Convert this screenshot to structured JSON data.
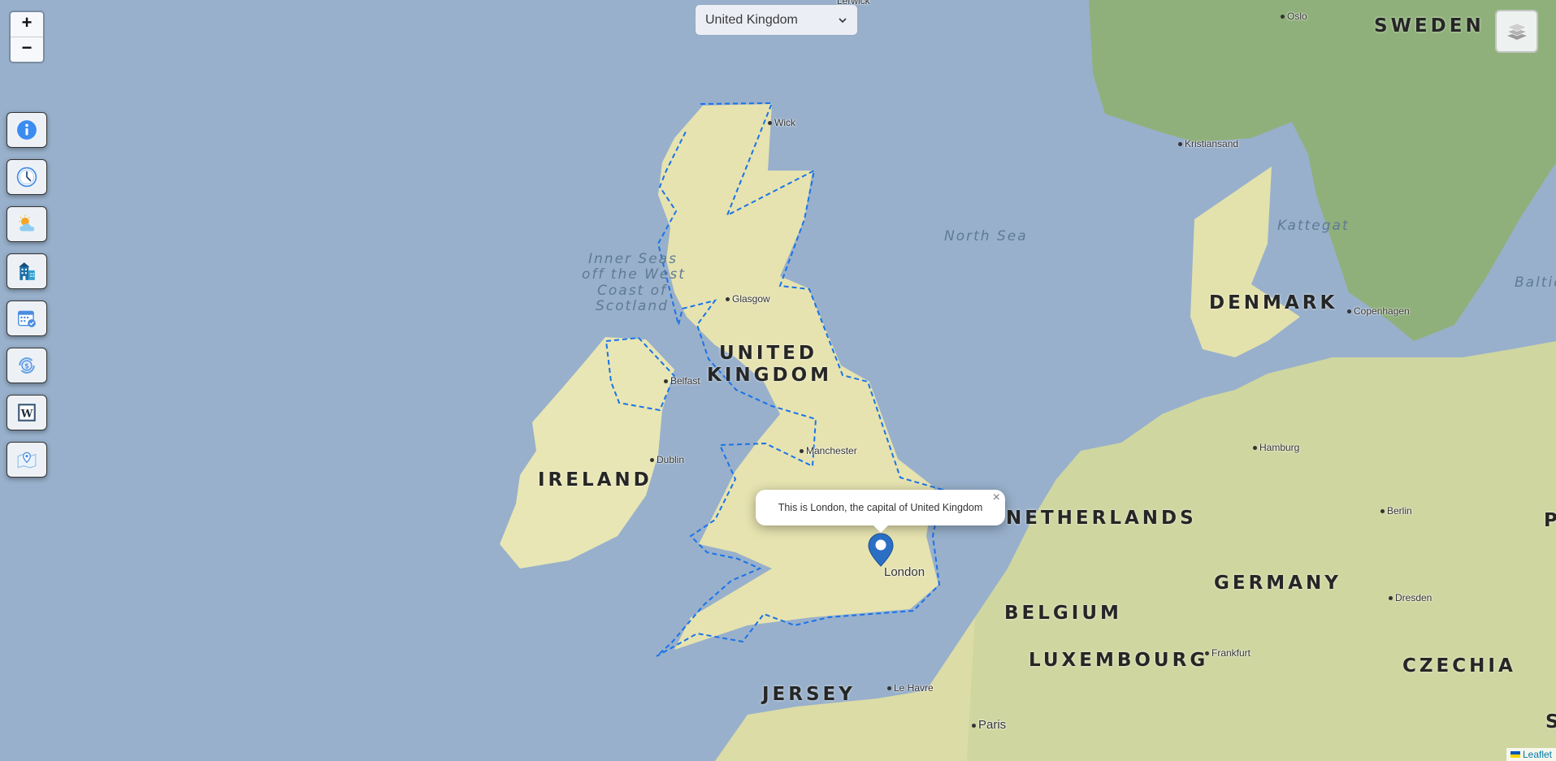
{
  "map": {
    "zoom_in_label": "+",
    "zoom_out_label": "−",
    "country_select": {
      "selected": "United Kingdom"
    },
    "popup": {
      "text": "This is London, the capital of United Kingdom",
      "close_label": "×"
    },
    "marker": {
      "city": "London",
      "color": "#2a6fc4"
    },
    "highlight_color": "#1a73e8",
    "attribution": {
      "label": "Leaflet"
    },
    "tools": [
      {
        "name": "info",
        "icon": "info-icon"
      },
      {
        "name": "time",
        "icon": "clock-icon"
      },
      {
        "name": "weather",
        "icon": "weather-icon"
      },
      {
        "name": "buildings",
        "icon": "buildings-icon"
      },
      {
        "name": "calendar",
        "icon": "calendar-check-icon"
      },
      {
        "name": "currency",
        "icon": "currency-exchange-icon"
      },
      {
        "name": "wikipedia",
        "icon": "wikipedia-icon"
      },
      {
        "name": "location",
        "icon": "map-pin-icon"
      }
    ],
    "country_labels": {
      "uk_line1": "UNITED",
      "uk_line2": "KINGDOM",
      "ireland": "IRELAND",
      "sweden": "SWEDEN",
      "denmark": "DENMARK",
      "netherlands": "NETHERLANDS",
      "belgium": "BELGIUM",
      "luxembourg": "LUXEMBOURG",
      "germany": "GERMANY",
      "czechia": "CZECHIA",
      "jersey": "JERSEY",
      "edge_p": "P",
      "edge_s": "S"
    },
    "sea_labels": {
      "north_sea": "North Sea",
      "kattegat": "Kattegat",
      "baltic": "Baltic",
      "inner_seas_1": "Inner Seas",
      "inner_seas_2": "off the West",
      "inner_seas_3": "Coast of",
      "inner_seas_4": "Scotland"
    },
    "city_labels": {
      "lerwick": "Lerwick",
      "wick": "Wick",
      "glasgow": "Glasgow",
      "belfast": "Belfast",
      "dublin": "Dublin",
      "manchester": "Manchester",
      "london": "London",
      "le_havre": "Le Havre",
      "paris": "Paris",
      "oslo": "Oslo",
      "kristiansand": "Kristiansand",
      "copenhagen": "Copenhagen",
      "hamburg": "Hamburg",
      "berlin": "Berlin",
      "dresden": "Dresden",
      "frankfurt": "Frankfurt"
    }
  }
}
